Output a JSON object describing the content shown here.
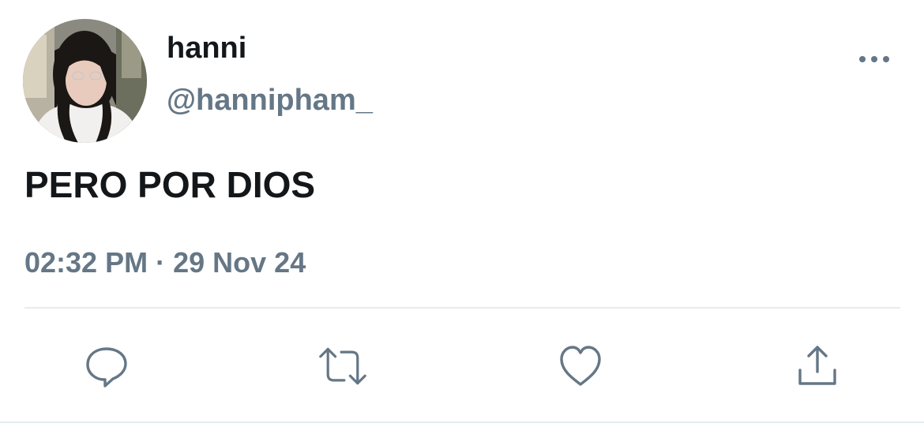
{
  "tweet": {
    "display_name": "hanni",
    "handle": "@hannipham_",
    "text": "PERO POR DIOS",
    "time": "02:32 PM",
    "separator": "·",
    "date": "29 Nov 24"
  },
  "icons": {
    "more": "more-horizontal-icon",
    "reply": "reply-icon",
    "retweet": "retweet-icon",
    "like": "heart-icon",
    "share": "share-icon"
  },
  "colors": {
    "text": "#14171a",
    "secondary": "#657786",
    "divider": "#e6ecf0",
    "background": "#ffffff"
  }
}
